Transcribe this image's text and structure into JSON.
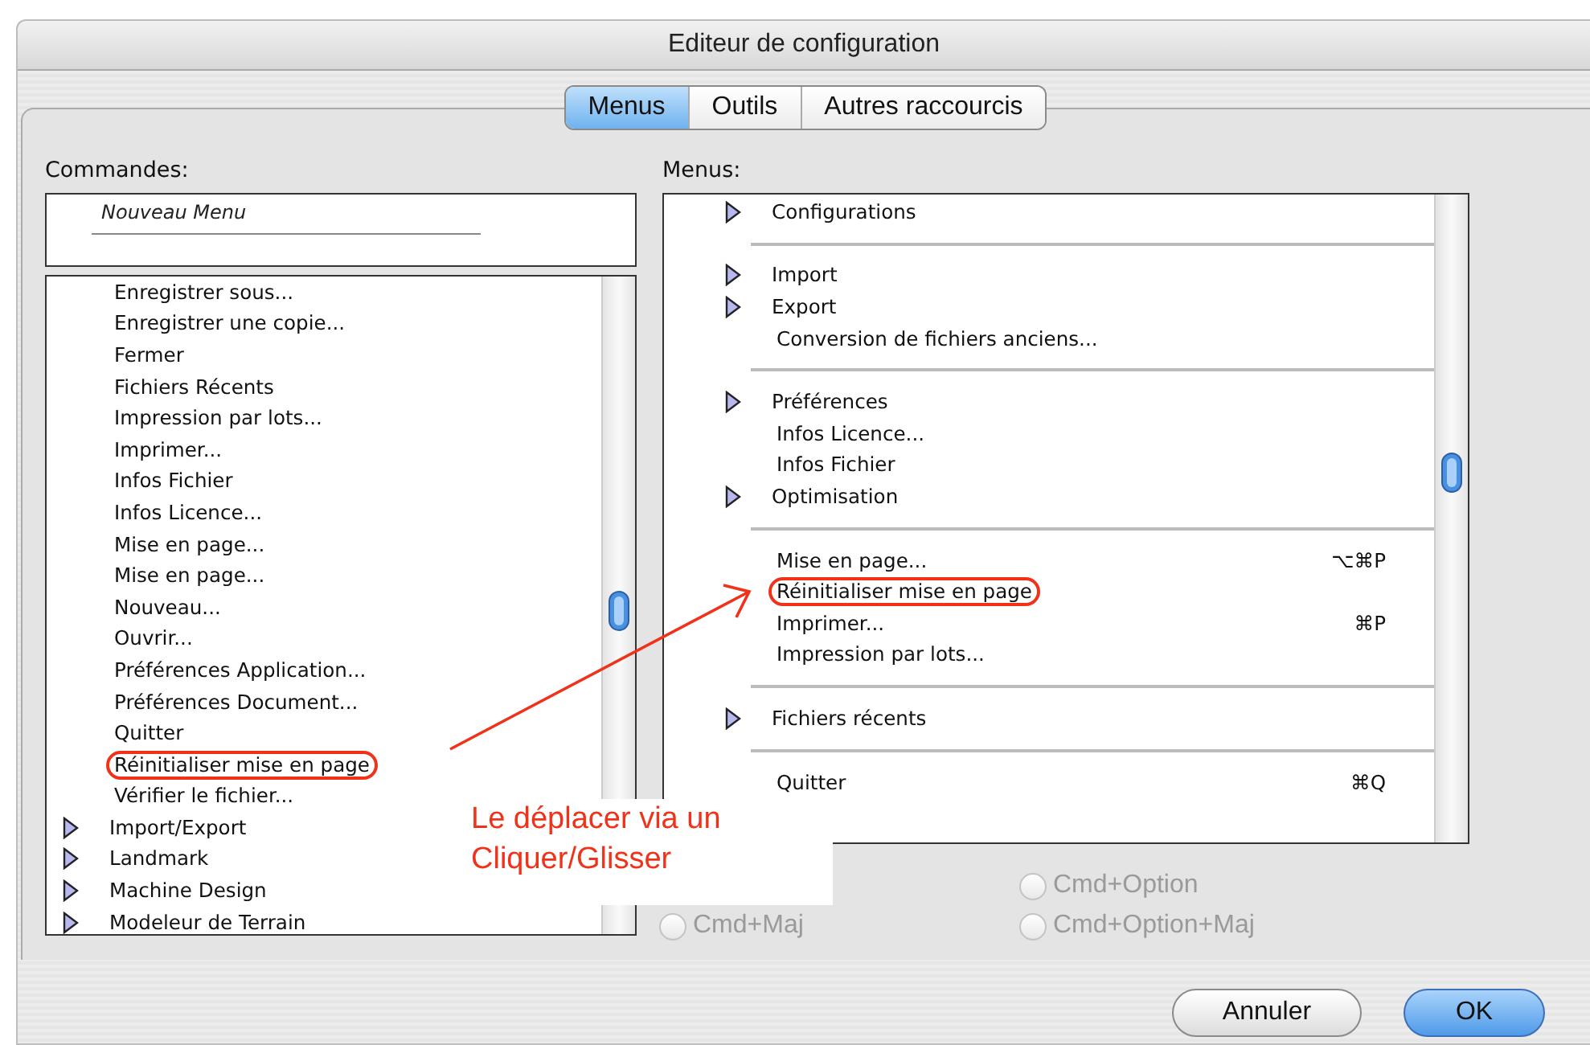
{
  "window": {
    "title": "Editeur de configuration"
  },
  "tabs": [
    {
      "label": "Menus",
      "selected": true
    },
    {
      "label": "Outils",
      "selected": false
    },
    {
      "label": "Autres raccourcis",
      "selected": false
    }
  ],
  "commands": {
    "label": "Commandes:",
    "new_menu": "Nouveau Menu",
    "items": [
      {
        "kind": "command",
        "label": "Enregistrer sous...",
        "circled": false
      },
      {
        "kind": "command",
        "label": "Enregistrer une copie...",
        "circled": false
      },
      {
        "kind": "command",
        "label": "Fermer",
        "circled": false
      },
      {
        "kind": "command",
        "label": "Fichiers Récents",
        "circled": false
      },
      {
        "kind": "command",
        "label": "Impression par lots...",
        "circled": false
      },
      {
        "kind": "command",
        "label": "Imprimer...",
        "circled": false
      },
      {
        "kind": "command",
        "label": "Infos Fichier",
        "circled": false
      },
      {
        "kind": "command",
        "label": "Infos Licence...",
        "circled": false
      },
      {
        "kind": "command",
        "label": "Mise en page...",
        "circled": false
      },
      {
        "kind": "command",
        "label": "Mise en page...",
        "circled": false
      },
      {
        "kind": "command",
        "label": "Nouveau...",
        "circled": false
      },
      {
        "kind": "command",
        "label": "Ouvrir...",
        "circled": false
      },
      {
        "kind": "command",
        "label": "Préférences Application...",
        "circled": false
      },
      {
        "kind": "command",
        "label": "Préférences Document...",
        "circled": false
      },
      {
        "kind": "command",
        "label": "Quitter",
        "circled": false
      },
      {
        "kind": "command",
        "label": "Réinitialiser mise en page",
        "circled": true
      },
      {
        "kind": "command",
        "label": "Vérifier le fichier...",
        "circled": false
      },
      {
        "kind": "submenu",
        "label": "Import/Export",
        "circled": false
      },
      {
        "kind": "submenu",
        "label": "Landmark",
        "circled": false
      },
      {
        "kind": "submenu",
        "label": "Machine Design",
        "circled": false
      },
      {
        "kind": "submenu",
        "label": "Modeleur de Terrain",
        "circled": false
      }
    ]
  },
  "menus": {
    "label": "Menus:",
    "sections": [
      [
        {
          "kind": "submenu",
          "label": "Configurations",
          "circled": false
        }
      ],
      [
        {
          "kind": "submenu",
          "label": "Import",
          "circled": false
        },
        {
          "kind": "submenu",
          "label": "Export",
          "circled": false
        },
        {
          "kind": "command",
          "label": "Conversion de fichiers anciens...",
          "circled": false
        }
      ],
      [
        {
          "kind": "submenu",
          "label": "Préférences",
          "circled": false
        },
        {
          "kind": "command",
          "label": "Infos Licence...",
          "circled": false
        },
        {
          "kind": "command",
          "label": "Infos Fichier",
          "circled": false
        },
        {
          "kind": "submenu",
          "label": "Optimisation",
          "circled": false
        }
      ],
      [
        {
          "kind": "command",
          "label": "Mise en page...",
          "shortcut": "⌥⌘P",
          "circled": false
        },
        {
          "kind": "command",
          "label": "Réinitialiser mise en page",
          "circled": true
        },
        {
          "kind": "command",
          "label": "Imprimer...",
          "shortcut": "⌘P",
          "circled": false
        },
        {
          "kind": "command",
          "label": "Impression par lots...",
          "circled": false
        }
      ],
      [
        {
          "kind": "submenu",
          "label": "Fichiers récents",
          "circled": false
        }
      ],
      [
        {
          "kind": "command",
          "label": "Quitter",
          "shortcut": "⌘Q",
          "circled": false
        }
      ]
    ]
  },
  "shortcut_options": [
    [
      {
        "label": "Cmd+Maj",
        "disabled": true,
        "selected": false
      }
    ],
    [
      {
        "label": "Cmd+Option",
        "disabled": true,
        "selected": false
      },
      {
        "label": "Cmd+Option+Maj",
        "disabled": true,
        "selected": false
      }
    ]
  ],
  "annotation": {
    "text": "Le déplacer via un Cliquer/Glisser"
  },
  "buttons": [
    {
      "label": "Annuler",
      "default": false
    },
    {
      "label": "OK",
      "default": true
    }
  ]
}
